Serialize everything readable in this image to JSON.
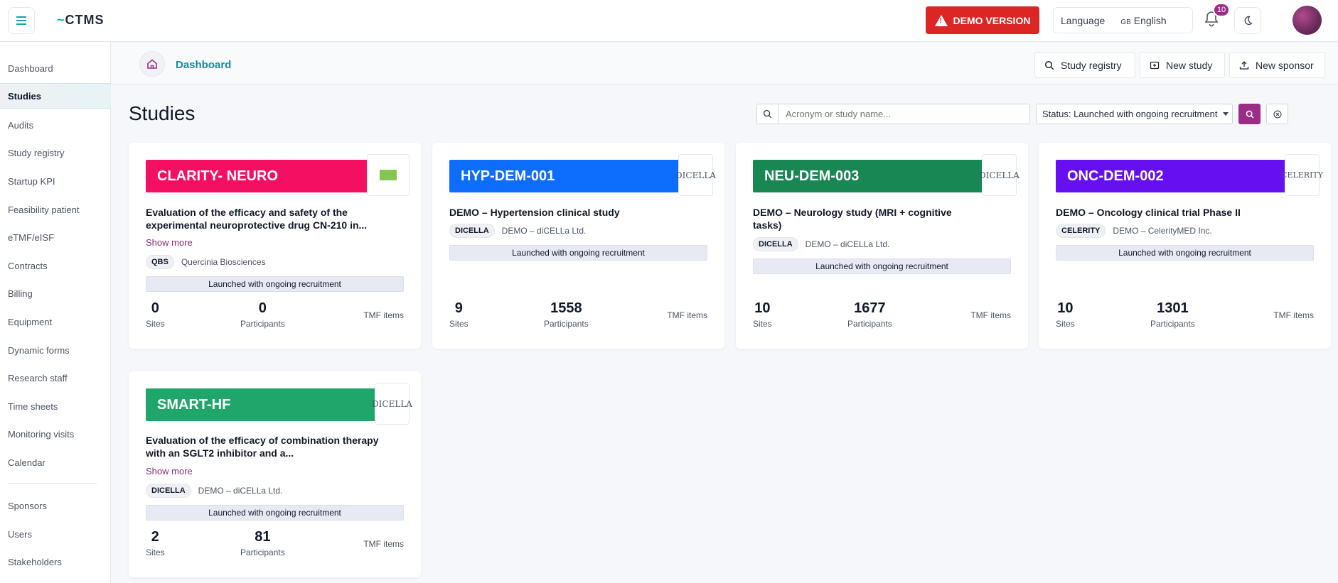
{
  "app": {
    "logo": "CTMS",
    "logo_mark": "~"
  },
  "header": {
    "demo_label": "DEMO VERSION",
    "language_label": "Language",
    "language_flag": "GB",
    "language_value": "English",
    "notifications_count": "10"
  },
  "sidebar": {
    "items": [
      {
        "label": "Dashboard"
      },
      {
        "label": "Studies"
      },
      {
        "label": "Audits"
      },
      {
        "label": "Study registry"
      },
      {
        "label": "Startup KPI"
      },
      {
        "label": "Feasibility patient"
      },
      {
        "label": "eTMF/eISF"
      },
      {
        "label": "Contracts"
      },
      {
        "label": "Billing"
      },
      {
        "label": "Equipment"
      },
      {
        "label": "Dynamic forms"
      },
      {
        "label": "Research staff"
      },
      {
        "label": "Time sheets"
      },
      {
        "label": "Monitoring visits"
      },
      {
        "label": "Calendar"
      },
      {
        "label": "Sponsors"
      },
      {
        "label": "Users"
      },
      {
        "label": "Stakeholders"
      }
    ]
  },
  "breadcrumb": {
    "label": "Dashboard"
  },
  "actions": {
    "study_registry": "Study registry",
    "new_study": "New study",
    "new_sponsor": "New sponsor"
  },
  "page": {
    "title": "Studies",
    "search_placeholder": "Acronym or study name...",
    "status_filter": "Status: Launched with ongoing recruitment"
  },
  "labels": {
    "show_more": "Show more",
    "sites": "Sites",
    "participants": "Participants",
    "tmf_items": "TMF items"
  },
  "colors": {
    "accent": "#9b2d87",
    "teal": "#0e8fa3",
    "demo_red": "#dc2626"
  },
  "studies": [
    {
      "acronym": "CLARITY- NEURO",
      "color": "#f50f62",
      "sponsor_logo": "",
      "description": "Evaluation of the efficacy and safety of the experimental neuroprotective drug CN-210 in...",
      "sponsor_code": "QBS",
      "sponsor_name": "Quercinia Biosciences",
      "status": "Launched with ongoing recruitment",
      "sites": "0",
      "participants": "0"
    },
    {
      "acronym": "HYP-DEM-001",
      "color": "#0d6efd",
      "sponsor_logo": "DICELLA",
      "description": "DEMO – Hypertension clinical study",
      "sponsor_code": "DICELLA",
      "sponsor_name": "DEMO – diCELLa Ltd.",
      "status": "Launched with ongoing recruitment",
      "sites": "9",
      "participants": "1558"
    },
    {
      "acronym": "NEU-DEM-003",
      "color": "#198754",
      "sponsor_logo": "DICELLA",
      "description": "DEMO – Neurology study (MRI + cognitive tasks)",
      "sponsor_code": "DICELLA",
      "sponsor_name": "DEMO – diCELLa Ltd.",
      "status": "Launched with ongoing recruitment",
      "sites": "10",
      "participants": "1677"
    },
    {
      "acronym": "ONC-DEM-002",
      "color": "#6610f2",
      "sponsor_logo": "CELERITY",
      "description": "DEMO – Oncology clinical trial Phase II",
      "sponsor_code": "CELERITY",
      "sponsor_name": "DEMO – CelerityMED Inc.",
      "status": "Launched with ongoing recruitment",
      "sites": "10",
      "participants": "1301"
    },
    {
      "acronym": "SMART-HF",
      "color": "#20a66b",
      "sponsor_logo": "DICELLA",
      "description": "Evaluation of the efficacy of combination therapy with an SGLT2 inhibitor and a...",
      "sponsor_code": "DICELLA",
      "sponsor_name": "DEMO – diCELLa Ltd.",
      "status": "Launched with ongoing recruitment",
      "sites": "2",
      "participants": "81"
    }
  ]
}
